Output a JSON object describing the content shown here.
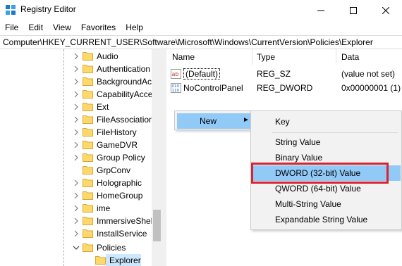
{
  "window": {
    "title": "Registry Editor",
    "controls": {
      "minimize": "minimize-icon",
      "maximize": "maximize-icon",
      "close": "close-icon"
    }
  },
  "menubar": {
    "items": [
      "File",
      "Edit",
      "View",
      "Favorites",
      "Help"
    ]
  },
  "address": {
    "path": "Computer\\HKEY_CURRENT_USER\\Software\\Microsoft\\Windows\\CurrentVersion\\Policies\\Explorer"
  },
  "tree": {
    "items": [
      {
        "label": "Audio"
      },
      {
        "label": "Authentication"
      },
      {
        "label": "BackgroundAccessApplications"
      },
      {
        "label": "CapabilityAccessManager"
      },
      {
        "label": "Ext"
      },
      {
        "label": "FileAssociations"
      },
      {
        "label": "FileHistory"
      },
      {
        "label": "GameDVR"
      },
      {
        "label": "Group Policy"
      },
      {
        "label": "GrpConv"
      },
      {
        "label": "Holographic"
      },
      {
        "label": "HomeGroup"
      },
      {
        "label": "ime"
      },
      {
        "label": "ImmersiveShell"
      },
      {
        "label": "InstallService"
      },
      {
        "label": "Policies"
      },
      {
        "label": "Explorer"
      }
    ]
  },
  "list": {
    "columns": [
      "Name",
      "Type",
      "Data"
    ],
    "rows": [
      {
        "name": "(Default)",
        "type": "REG_SZ",
        "data": "(value not set)",
        "icon": "string-value-icon"
      },
      {
        "name": "NoControlPanel",
        "type": "REG_DWORD",
        "data": "0x00000001 (1)",
        "icon": "binary-value-icon"
      }
    ]
  },
  "context_menu": {
    "new_label": "New",
    "submenu": [
      "Key",
      "String Value",
      "Binary Value",
      "DWORD (32-bit) Value",
      "QWORD (64-bit) Value",
      "Multi-String Value",
      "Expandable String Value"
    ],
    "highlighted": "DWORD (32-bit) Value",
    "highlight_color": "#91c9f7",
    "annotation_color": "#d9232e"
  }
}
